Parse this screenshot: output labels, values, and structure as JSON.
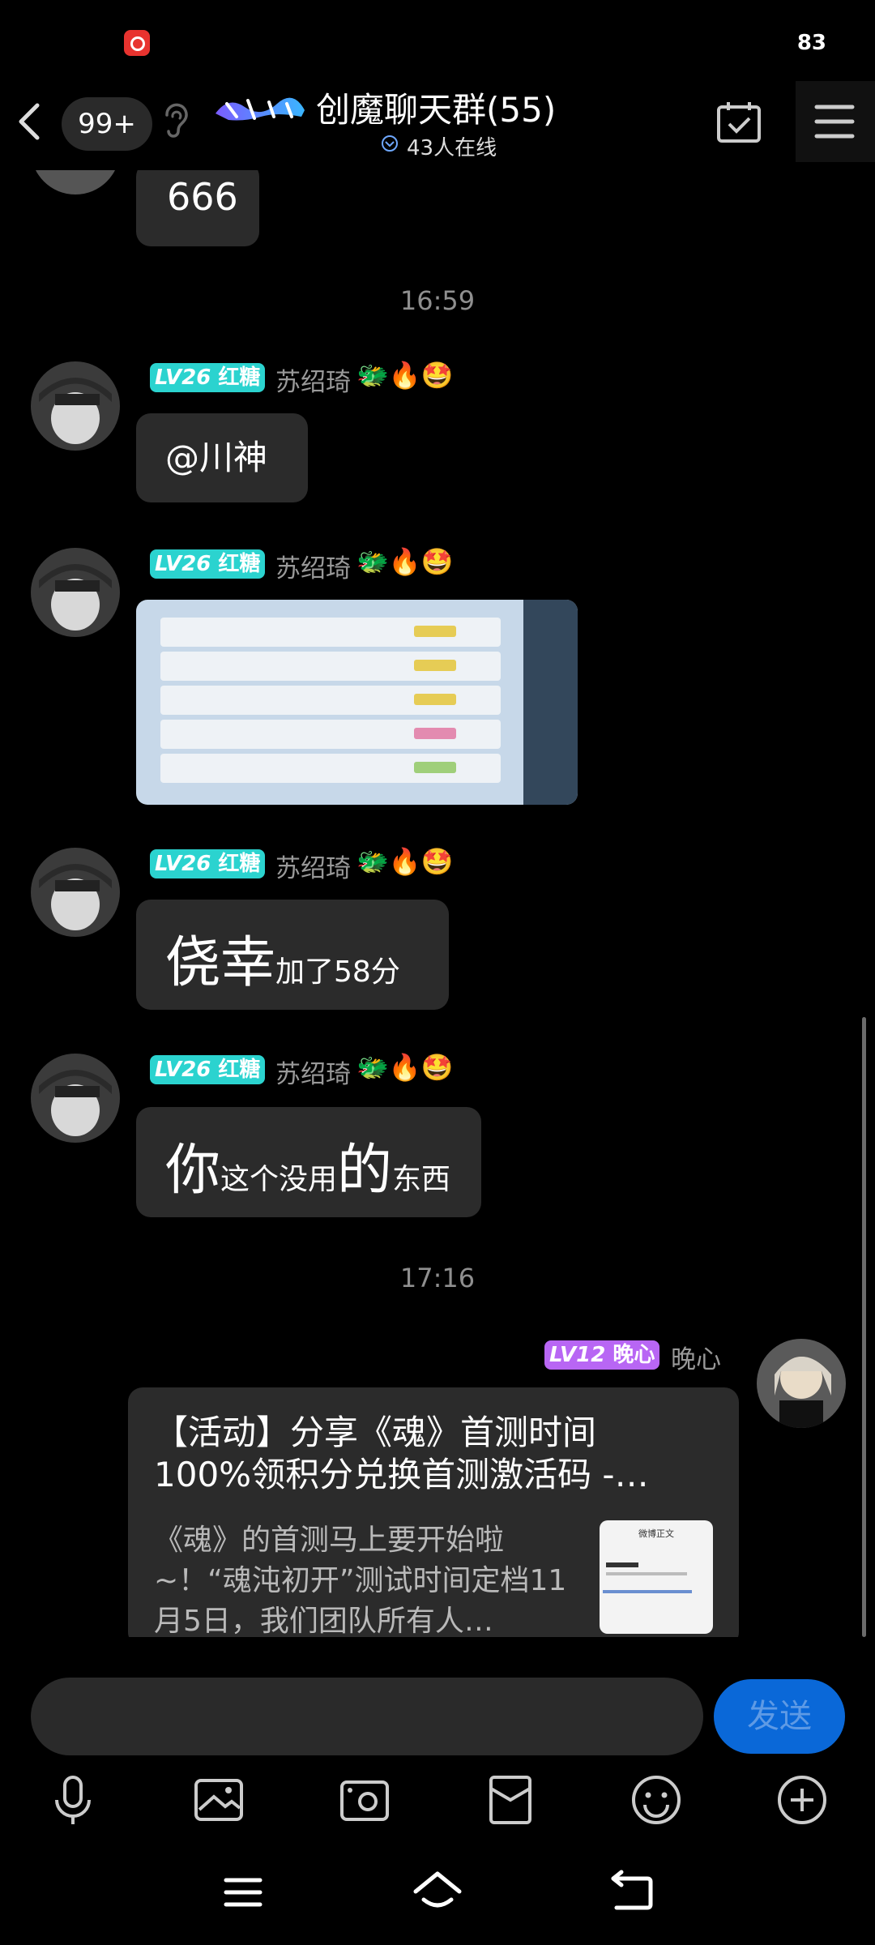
{
  "status_bar": {
    "battery": "83"
  },
  "header": {
    "unread_count": "99+",
    "group_name": "创魔聊天群(55)",
    "online_count": "43人在线"
  },
  "messages": [
    {
      "text": "666"
    },
    {
      "time": "16:59"
    },
    {
      "level": "LV26",
      "title": "红糖",
      "sender": "苏绍琦",
      "text": "@川神"
    },
    {
      "level": "LV26",
      "title": "红糖",
      "sender": "苏绍琦"
    },
    {
      "level": "LV26",
      "title": "红糖",
      "sender": "苏绍琦",
      "parts": [
        "侥幸",
        "加了58分"
      ]
    },
    {
      "level": "LV26",
      "title": "红糖",
      "sender": "苏绍琦",
      "parts": [
        "你",
        "这个没用",
        "的",
        "东西"
      ]
    },
    {
      "time": "17:16"
    },
    {
      "level": "LV12",
      "title": "晚心",
      "sender": "晚心",
      "card": {
        "title": "【活动】分享《魂》首测时间100%领积分兑换首测激活码 -…",
        "description": "《魂》的首测马上要开始啦~！“魂沌初开”测试时间定档11月5日，我们团队所有人…",
        "thumb_caption": "微博正文"
      }
    }
  ],
  "composer": {
    "send_label": "发送"
  },
  "colors": {
    "accent": "#0a68d8",
    "badge_teal": "#2bd3cf",
    "badge_purple": "#b866f4"
  }
}
